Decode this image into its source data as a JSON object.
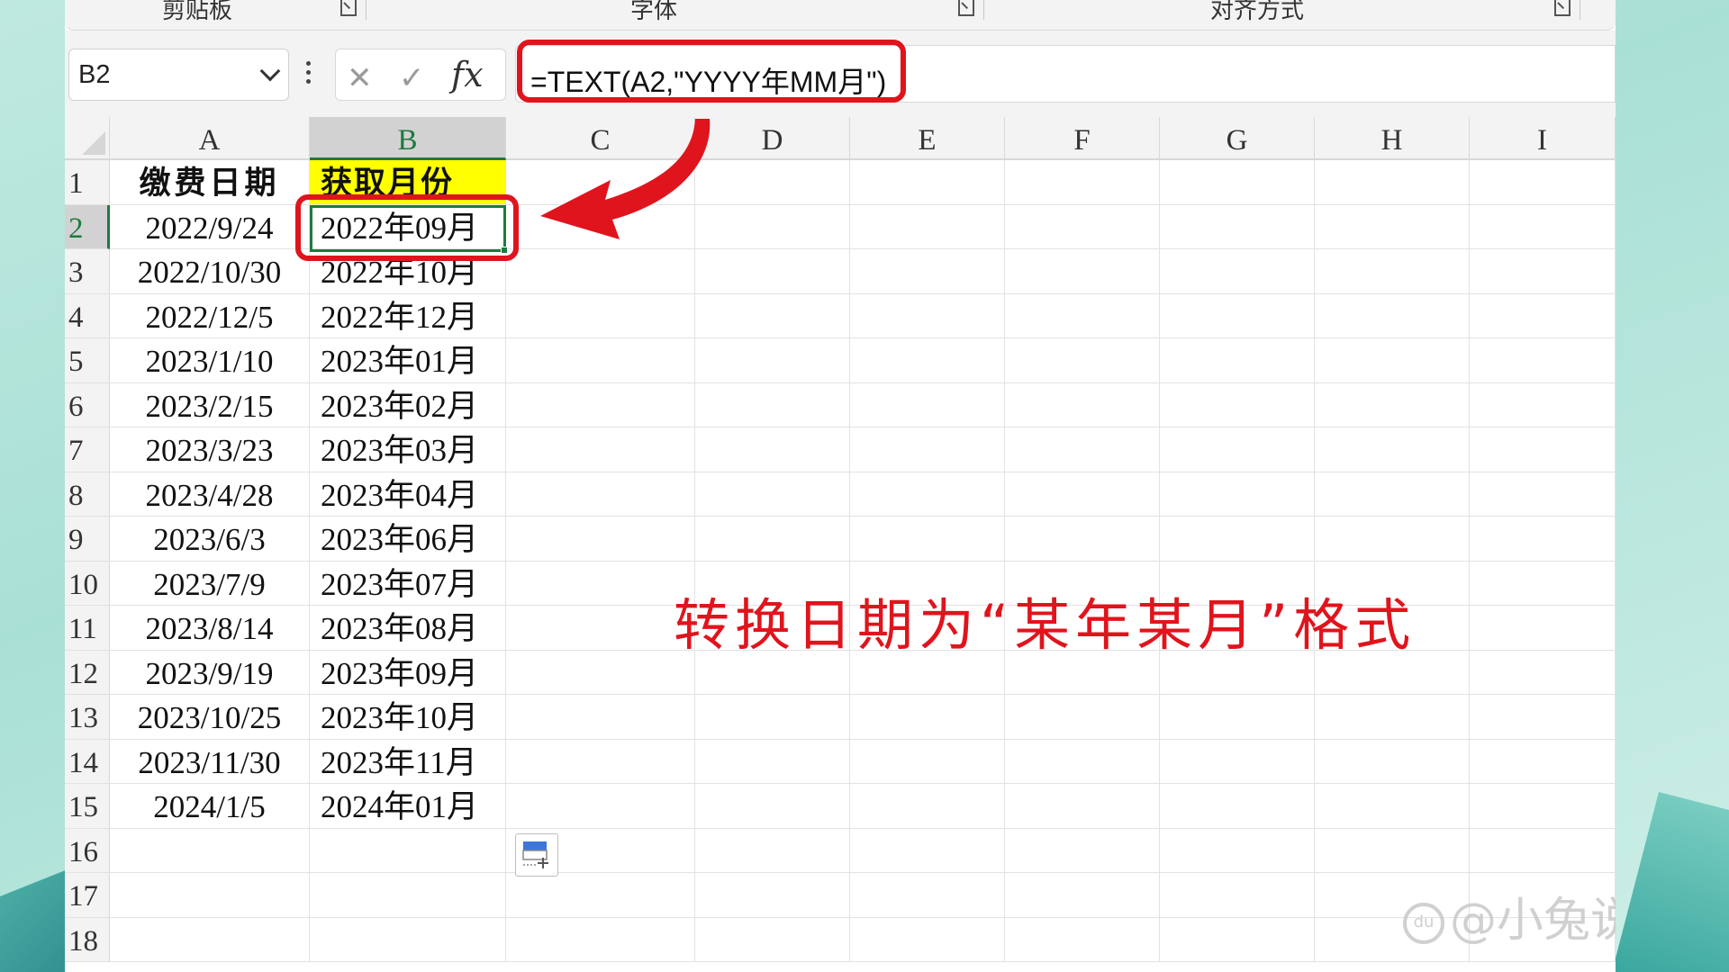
{
  "ribbon": {
    "groups": [
      "剪贴板",
      "字体",
      "对齐方式"
    ]
  },
  "formula_bar": {
    "name_box": "B2",
    "formula": "=TEXT(A2,\"YYYY年MM月\")",
    "cancel_glyph": "✕",
    "enter_glyph": "✓",
    "fx_label": "fx"
  },
  "columns": [
    "A",
    "B",
    "C",
    "D",
    "E",
    "F",
    "G",
    "H",
    "I"
  ],
  "rows": [
    {
      "num": "1",
      "a": "缴费日期",
      "b": "获取月份"
    },
    {
      "num": "2",
      "a": "2022/9/24",
      "b": "2022年09月"
    },
    {
      "num": "3",
      "a": "2022/10/30",
      "b": "2022年10月"
    },
    {
      "num": "4",
      "a": "2022/12/5",
      "b": "2022年12月"
    },
    {
      "num": "5",
      "a": "2023/1/10",
      "b": "2023年01月"
    },
    {
      "num": "6",
      "a": "2023/2/15",
      "b": "2023年02月"
    },
    {
      "num": "7",
      "a": "2023/3/23",
      "b": "2023年03月"
    },
    {
      "num": "8",
      "a": "2023/4/28",
      "b": "2023年04月"
    },
    {
      "num": "9",
      "a": "2023/6/3",
      "b": "2023年06月"
    },
    {
      "num": "10",
      "a": "2023/7/9",
      "b": "2023年07月"
    },
    {
      "num": "11",
      "a": "2023/8/14",
      "b": "2023年08月"
    },
    {
      "num": "12",
      "a": "2023/9/19",
      "b": "2023年09月"
    },
    {
      "num": "13",
      "a": "2023/10/25",
      "b": "2023年10月"
    },
    {
      "num": "14",
      "a": "2023/11/30",
      "b": "2023年11月"
    },
    {
      "num": "15",
      "a": "2024/1/5",
      "b": "2024年01月"
    },
    {
      "num": "16",
      "a": "",
      "b": ""
    },
    {
      "num": "17",
      "a": "",
      "b": ""
    },
    {
      "num": "18",
      "a": "",
      "b": ""
    }
  ],
  "annotation": "转换日期为“某年某月”格式",
  "watermark": "@小兔说Excel",
  "colors": {
    "highlight_red": "#e0141c",
    "header_yellow": "#ffff00",
    "excel_green": "#1f7a3e"
  }
}
